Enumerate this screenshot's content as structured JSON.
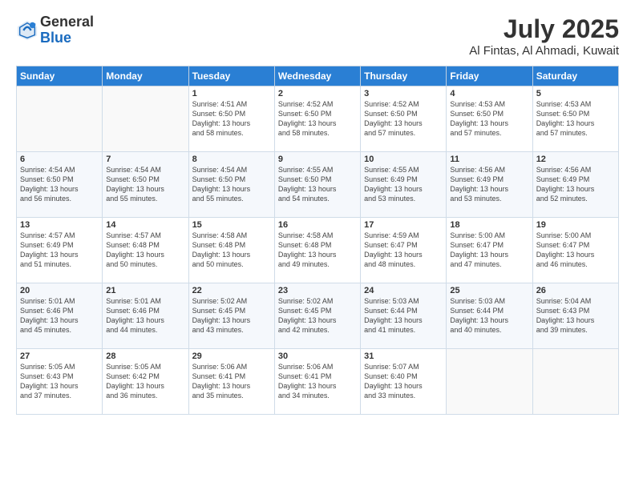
{
  "header": {
    "logo_line1": "General",
    "logo_line2": "Blue",
    "month": "July 2025",
    "location": "Al Fintas, Al Ahmadi, Kuwait"
  },
  "weekdays": [
    "Sunday",
    "Monday",
    "Tuesday",
    "Wednesday",
    "Thursday",
    "Friday",
    "Saturday"
  ],
  "weeks": [
    [
      {
        "day": "",
        "detail": ""
      },
      {
        "day": "",
        "detail": ""
      },
      {
        "day": "1",
        "detail": "Sunrise: 4:51 AM\nSunset: 6:50 PM\nDaylight: 13 hours\nand 58 minutes."
      },
      {
        "day": "2",
        "detail": "Sunrise: 4:52 AM\nSunset: 6:50 PM\nDaylight: 13 hours\nand 58 minutes."
      },
      {
        "day": "3",
        "detail": "Sunrise: 4:52 AM\nSunset: 6:50 PM\nDaylight: 13 hours\nand 57 minutes."
      },
      {
        "day": "4",
        "detail": "Sunrise: 4:53 AM\nSunset: 6:50 PM\nDaylight: 13 hours\nand 57 minutes."
      },
      {
        "day": "5",
        "detail": "Sunrise: 4:53 AM\nSunset: 6:50 PM\nDaylight: 13 hours\nand 57 minutes."
      }
    ],
    [
      {
        "day": "6",
        "detail": "Sunrise: 4:54 AM\nSunset: 6:50 PM\nDaylight: 13 hours\nand 56 minutes."
      },
      {
        "day": "7",
        "detail": "Sunrise: 4:54 AM\nSunset: 6:50 PM\nDaylight: 13 hours\nand 55 minutes."
      },
      {
        "day": "8",
        "detail": "Sunrise: 4:54 AM\nSunset: 6:50 PM\nDaylight: 13 hours\nand 55 minutes."
      },
      {
        "day": "9",
        "detail": "Sunrise: 4:55 AM\nSunset: 6:50 PM\nDaylight: 13 hours\nand 54 minutes."
      },
      {
        "day": "10",
        "detail": "Sunrise: 4:55 AM\nSunset: 6:49 PM\nDaylight: 13 hours\nand 53 minutes."
      },
      {
        "day": "11",
        "detail": "Sunrise: 4:56 AM\nSunset: 6:49 PM\nDaylight: 13 hours\nand 53 minutes."
      },
      {
        "day": "12",
        "detail": "Sunrise: 4:56 AM\nSunset: 6:49 PM\nDaylight: 13 hours\nand 52 minutes."
      }
    ],
    [
      {
        "day": "13",
        "detail": "Sunrise: 4:57 AM\nSunset: 6:49 PM\nDaylight: 13 hours\nand 51 minutes."
      },
      {
        "day": "14",
        "detail": "Sunrise: 4:57 AM\nSunset: 6:48 PM\nDaylight: 13 hours\nand 50 minutes."
      },
      {
        "day": "15",
        "detail": "Sunrise: 4:58 AM\nSunset: 6:48 PM\nDaylight: 13 hours\nand 50 minutes."
      },
      {
        "day": "16",
        "detail": "Sunrise: 4:58 AM\nSunset: 6:48 PM\nDaylight: 13 hours\nand 49 minutes."
      },
      {
        "day": "17",
        "detail": "Sunrise: 4:59 AM\nSunset: 6:47 PM\nDaylight: 13 hours\nand 48 minutes."
      },
      {
        "day": "18",
        "detail": "Sunrise: 5:00 AM\nSunset: 6:47 PM\nDaylight: 13 hours\nand 47 minutes."
      },
      {
        "day": "19",
        "detail": "Sunrise: 5:00 AM\nSunset: 6:47 PM\nDaylight: 13 hours\nand 46 minutes."
      }
    ],
    [
      {
        "day": "20",
        "detail": "Sunrise: 5:01 AM\nSunset: 6:46 PM\nDaylight: 13 hours\nand 45 minutes."
      },
      {
        "day": "21",
        "detail": "Sunrise: 5:01 AM\nSunset: 6:46 PM\nDaylight: 13 hours\nand 44 minutes."
      },
      {
        "day": "22",
        "detail": "Sunrise: 5:02 AM\nSunset: 6:45 PM\nDaylight: 13 hours\nand 43 minutes."
      },
      {
        "day": "23",
        "detail": "Sunrise: 5:02 AM\nSunset: 6:45 PM\nDaylight: 13 hours\nand 42 minutes."
      },
      {
        "day": "24",
        "detail": "Sunrise: 5:03 AM\nSunset: 6:44 PM\nDaylight: 13 hours\nand 41 minutes."
      },
      {
        "day": "25",
        "detail": "Sunrise: 5:03 AM\nSunset: 6:44 PM\nDaylight: 13 hours\nand 40 minutes."
      },
      {
        "day": "26",
        "detail": "Sunrise: 5:04 AM\nSunset: 6:43 PM\nDaylight: 13 hours\nand 39 minutes."
      }
    ],
    [
      {
        "day": "27",
        "detail": "Sunrise: 5:05 AM\nSunset: 6:43 PM\nDaylight: 13 hours\nand 37 minutes."
      },
      {
        "day": "28",
        "detail": "Sunrise: 5:05 AM\nSunset: 6:42 PM\nDaylight: 13 hours\nand 36 minutes."
      },
      {
        "day": "29",
        "detail": "Sunrise: 5:06 AM\nSunset: 6:41 PM\nDaylight: 13 hours\nand 35 minutes."
      },
      {
        "day": "30",
        "detail": "Sunrise: 5:06 AM\nSunset: 6:41 PM\nDaylight: 13 hours\nand 34 minutes."
      },
      {
        "day": "31",
        "detail": "Sunrise: 5:07 AM\nSunset: 6:40 PM\nDaylight: 13 hours\nand 33 minutes."
      },
      {
        "day": "",
        "detail": ""
      },
      {
        "day": "",
        "detail": ""
      }
    ]
  ]
}
